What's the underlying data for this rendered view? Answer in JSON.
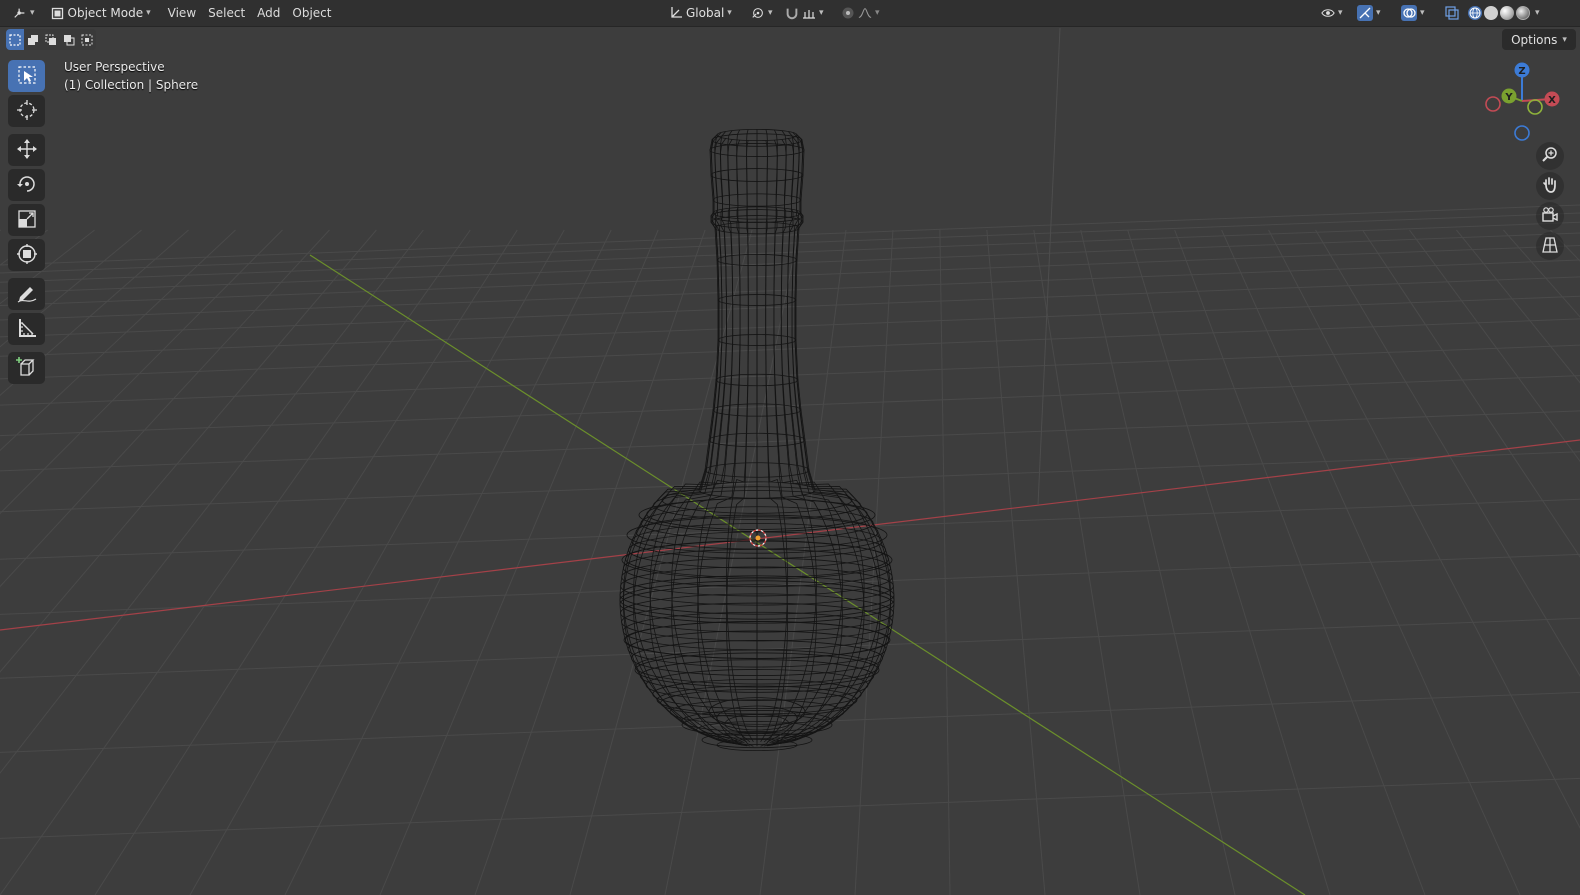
{
  "header": {
    "editor_type_icon": "orbit-editor-icon",
    "mode_label": "Object Mode",
    "menus": [
      "View",
      "Select",
      "Add",
      "Object"
    ],
    "transform_orientation": "Global",
    "pivot_icon": "pivot-icon",
    "snap_icon": "magnet-icon",
    "proportional_icon": "proportional-edit-icon"
  },
  "viewport": {
    "perspective_label": "User Perspective",
    "collection_label": "(1) Collection | Sphere",
    "options_label": "Options",
    "accent_color": "#4772b3",
    "axis_x_color": "#c44b55",
    "axis_y_color": "#7aa12f",
    "axis_z_color": "#3c7bd6"
  },
  "gizmo": {
    "x_label": "X",
    "y_label": "Y",
    "z_label": "Z"
  },
  "toolbar": {
    "tools": [
      "select-box",
      "cursor",
      "move",
      "rotate",
      "scale",
      "transform",
      "annotate",
      "measure",
      "add-cube"
    ],
    "active": "select-box"
  },
  "nav": [
    "zoom",
    "pan",
    "camera",
    "perspective-toggle"
  ]
}
